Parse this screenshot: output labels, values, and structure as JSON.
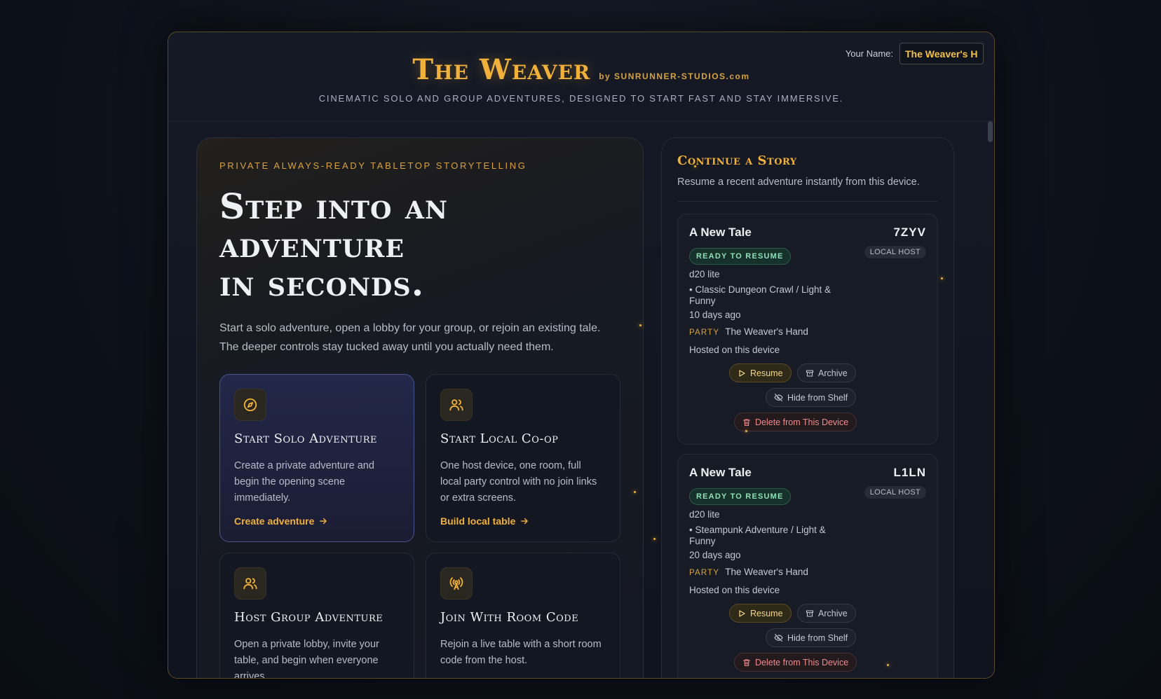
{
  "header": {
    "title": "The Weaver",
    "by": "by SUNRUNNER-STUDIOS.com",
    "tagline": "CINEMATIC SOLO AND GROUP ADVENTURES, DESIGNED TO START FAST AND STAY IMMERSIVE.",
    "name_label": "Your Name:",
    "name_value": "The Weaver's Hand"
  },
  "hero": {
    "eyebrow": "PRIVATE ALWAYS-READY TABLETOP STORYTELLING",
    "title_line1": "Step into an",
    "title_line2": "adventure",
    "title_line3": "in seconds.",
    "body": "Start a solo adventure, open a lobby for your group, or rejoin an existing tale. The deeper controls stay tucked away until you actually need them."
  },
  "actions": [
    {
      "icon": "compass-icon",
      "title": "Start Solo Adventure",
      "desc": "Create a private adventure and begin the opening scene immediately.",
      "link": "Create adventure"
    },
    {
      "icon": "users-icon",
      "title": "Start Local Co-op",
      "desc": "One host device, one room, full local party control with no join links or extra screens.",
      "link": "Build local table"
    },
    {
      "icon": "users-icon",
      "title": "Host Group Adventure",
      "desc": "Open a private lobby, invite your table, and begin when everyone arrives."
    },
    {
      "icon": "broadcast-icon",
      "title": "Join With Room Code",
      "desc": "Rejoin a live table with a short room code from the host."
    }
  ],
  "continue": {
    "title": "Continue a Story",
    "subtitle": "Resume a recent adventure instantly from this device.",
    "stories": [
      {
        "name": "A New Tale",
        "code": "7ZYV",
        "host_badge": "LOCAL HOST",
        "status": "READY TO RESUME",
        "ruleset": "d20 lite",
        "setting": "• Classic Dungeon Crawl / Light & Funny",
        "age": "10 days ago",
        "party_label": "PARTY",
        "party_name": "The Weaver's Hand",
        "hosted": "Hosted on this device",
        "resume": "Resume",
        "archive": "Archive",
        "hide": "Hide from Shelf",
        "delete": "Delete from This Device"
      },
      {
        "name": "A New Tale",
        "code": "L1LN",
        "host_badge": "LOCAL HOST",
        "status": "READY TO RESUME",
        "ruleset": "d20 lite",
        "setting": "• Steampunk Adventure / Light & Funny",
        "age": "20 days ago",
        "party_label": "PARTY",
        "party_name": "The Weaver's Hand",
        "hosted": "Hosted on this device",
        "resume": "Resume",
        "archive": "Archive",
        "hide": "Hide from Shelf",
        "delete": "Delete from This Device"
      }
    ]
  },
  "colors": {
    "accent_gold": "#f0b03a",
    "ready_green": "#8fe0b8",
    "delete_red": "#f08a8a",
    "selected_card": "#232749"
  }
}
